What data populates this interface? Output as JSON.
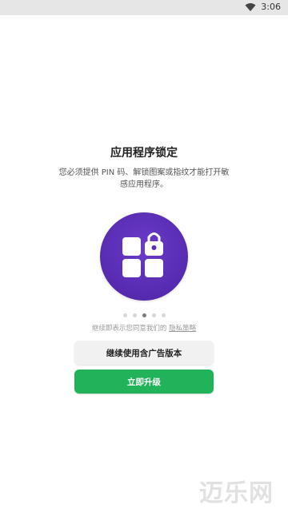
{
  "status_bar": {
    "time": "3:06",
    "wifi_icon": "wifi-icon"
  },
  "lock": {
    "title": "应用程序锁定",
    "description": "您必须提供 PIN 码、解锁图案或指纹才能打开敏感应用程序。",
    "hero_icon": "app-grid-lock-icon",
    "hero_color": "#5a2db4"
  },
  "pager": {
    "count": 5,
    "active_index": 2
  },
  "consent": {
    "text": "继续即表示您同意我们的",
    "link": "隐私策略"
  },
  "buttons": {
    "continue_ads": "继续使用含广告版本",
    "upgrade": "立即升级",
    "upgrade_color": "#22b35a"
  },
  "watermark": {
    "text": "迈乐网"
  }
}
